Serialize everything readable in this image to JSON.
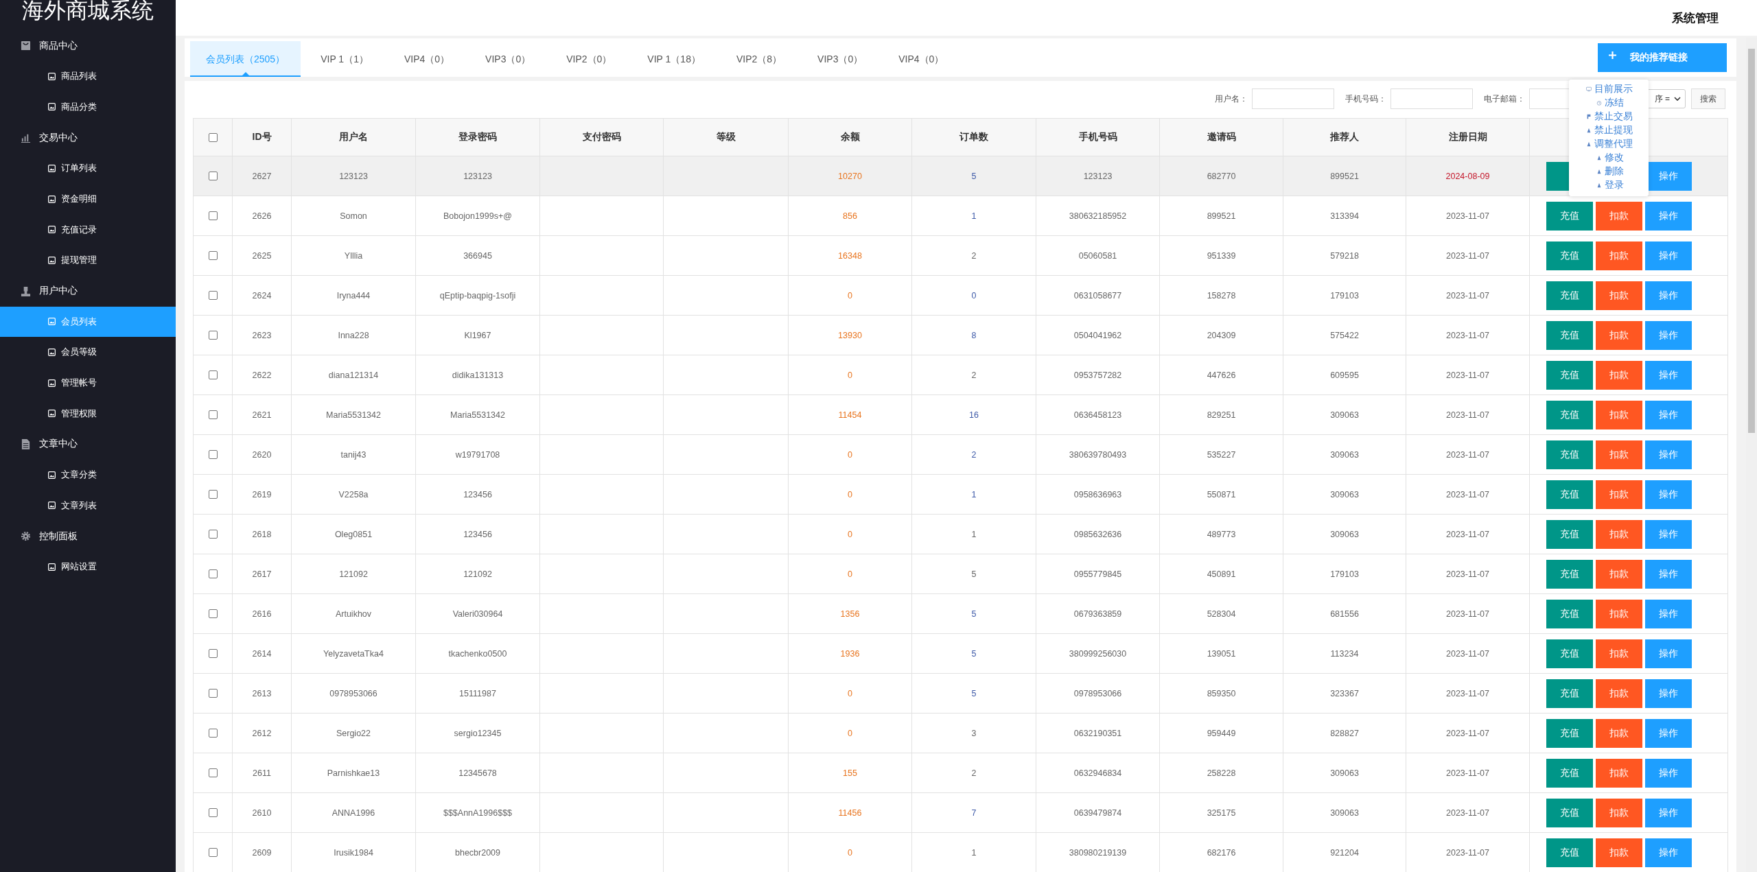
{
  "sidebar": {
    "title": "海外商城系统",
    "groups": [
      {
        "label": "商品中心",
        "items": [
          {
            "label": "商品列表",
            "selected": false
          },
          {
            "label": "商品分类",
            "selected": false
          }
        ]
      },
      {
        "label": "交易中心",
        "items": [
          {
            "label": "订单列表",
            "selected": false
          },
          {
            "label": "资金明细",
            "selected": false
          },
          {
            "label": "充值记录",
            "selected": false
          },
          {
            "label": "提现管理",
            "selected": false
          }
        ]
      },
      {
        "label": "用户中心",
        "items": [
          {
            "label": "会员列表",
            "selected": true
          },
          {
            "label": "会员等级",
            "selected": false
          },
          {
            "label": "管理帐号",
            "selected": false
          },
          {
            "label": "管理权限",
            "selected": false
          }
        ]
      },
      {
        "label": "文章中心",
        "items": [
          {
            "label": "文章分类",
            "selected": false
          },
          {
            "label": "文章列表",
            "selected": false
          }
        ]
      },
      {
        "label": "控制面板",
        "items": [
          {
            "label": "网站设置",
            "selected": false
          }
        ]
      }
    ]
  },
  "header": {
    "title": "系统管理"
  },
  "tabs": [
    {
      "label": "会员列表（2505）",
      "selected": true
    },
    {
      "label": "VIP 1（1）",
      "selected": false
    },
    {
      "label": "VIP4（0）",
      "selected": false
    },
    {
      "label": "VIP3（0）",
      "selected": false
    },
    {
      "label": "VIP2（0）",
      "selected": false
    },
    {
      "label": "VIP 1（18）",
      "selected": false
    },
    {
      "label": "VIP2（8）",
      "selected": false
    },
    {
      "label": "VIP3（0）",
      "selected": false
    },
    {
      "label": "VIP4（0）",
      "selected": false
    }
  ],
  "referral_button": "我的推荐链接",
  "filters": {
    "fields": [
      {
        "label": "用户名："
      },
      {
        "label": "手机号码："
      },
      {
        "label": "电子邮箱："
      }
    ],
    "sort": "序 =",
    "search_button": "搜索"
  },
  "menu": [
    {
      "label": "目前展示"
    },
    {
      "label": "冻结"
    },
    {
      "label": "禁止交易"
    },
    {
      "label": "禁止提现"
    },
    {
      "label": "调整代理"
    },
    {
      "label": "修改"
    },
    {
      "label": "删除"
    },
    {
      "label": "登录"
    }
  ],
  "table": {
    "all_checked": false,
    "columns": [
      "ID号",
      "用户名",
      "登录密码",
      "支付密码",
      "等级",
      "余额",
      "订单数",
      "手机号码",
      "邀请码",
      "推荐人",
      "注册日期"
    ],
    "rows": [
      {
        "id": "2627",
        "username": "123123",
        "login_password": "123123",
        "balance": "10270",
        "orders": "5",
        "orders_linked": true,
        "phone": "123123",
        "invite_code": "682770",
        "referrer": "899521",
        "registered": "2024-08-09",
        "date_highlight": true,
        "hovered": true,
        "checked": false,
        "actions": [
          {
            "kind": "recharge"
          },
          {
            "kind": "operate",
            "label": "操作"
          }
        ]
      },
      {
        "id": "2626",
        "username": "Somon",
        "login_password": "Bobojon1999s+@",
        "balance": "856",
        "orders": "1",
        "orders_linked": true,
        "phone": "380632185952",
        "invite_code": "899521",
        "referrer": "313394",
        "registered": "2023-11-07",
        "date_highlight": false,
        "hovered": false,
        "checked": false,
        "actions": [
          {
            "kind": "recharge",
            "label": "充值"
          },
          {
            "kind": "deduct",
            "label": "扣款"
          },
          {
            "kind": "operate",
            "label": "操作"
          }
        ]
      },
      {
        "id": "2625",
        "username": "Ylllia",
        "login_password": "366945",
        "balance": "16348",
        "orders": "2",
        "orders_linked": false,
        "phone": "05060581",
        "invite_code": "951339",
        "referrer": "579218",
        "registered": "2023-11-07",
        "date_highlight": false,
        "hovered": false,
        "checked": false,
        "actions": [
          {
            "kind": "recharge",
            "label": "充值"
          },
          {
            "kind": "deduct",
            "label": "扣款"
          },
          {
            "kind": "operate",
            "label": "操作"
          }
        ]
      },
      {
        "id": "2624",
        "username": "Iryna444",
        "login_password": "qEptip-baqpig-1sofji",
        "balance": "0",
        "orders": "0",
        "orders_linked": true,
        "phone": "0631058677",
        "invite_code": "158278",
        "referrer": "179103",
        "registered": "2023-11-07",
        "date_highlight": false,
        "hovered": false,
        "checked": false,
        "actions": [
          {
            "kind": "recharge",
            "label": "充值"
          },
          {
            "kind": "deduct",
            "label": "扣款"
          },
          {
            "kind": "operate",
            "label": "操作"
          }
        ]
      },
      {
        "id": "2623",
        "username": "Inna228",
        "login_password": "Kl1967",
        "balance": "13930",
        "orders": "8",
        "orders_linked": true,
        "phone": "0504041962",
        "invite_code": "204309",
        "referrer": "575422",
        "registered": "2023-11-07",
        "date_highlight": false,
        "hovered": false,
        "checked": false,
        "actions": [
          {
            "kind": "recharge",
            "label": "充值"
          },
          {
            "kind": "deduct",
            "label": "扣款"
          },
          {
            "kind": "operate",
            "label": "操作"
          }
        ]
      },
      {
        "id": "2622",
        "username": "diana121314",
        "login_password": "didika131313",
        "balance": "0",
        "orders": "2",
        "orders_linked": false,
        "phone": "0953757282",
        "invite_code": "447626",
        "referrer": "609595",
        "registered": "2023-11-07",
        "date_highlight": false,
        "hovered": false,
        "checked": false,
        "actions": [
          {
            "kind": "recharge",
            "label": "充值"
          },
          {
            "kind": "deduct",
            "label": "扣款"
          },
          {
            "kind": "operate",
            "label": "操作"
          }
        ]
      },
      {
        "id": "2621",
        "username": "Maria5531342",
        "login_password": "Maria5531342",
        "balance": "11454",
        "orders": "16",
        "orders_linked": true,
        "phone": "0636458123",
        "invite_code": "829251",
        "referrer": "309063",
        "registered": "2023-11-07",
        "date_highlight": false,
        "hovered": false,
        "checked": false,
        "actions": [
          {
            "kind": "recharge",
            "label": "充值"
          },
          {
            "kind": "deduct",
            "label": "扣款"
          },
          {
            "kind": "operate",
            "label": "操作"
          }
        ]
      },
      {
        "id": "2620",
        "username": "tanij43",
        "login_password": "w19791708",
        "balance": "0",
        "orders": "2",
        "orders_linked": true,
        "phone": "380639780493",
        "invite_code": "535227",
        "referrer": "309063",
        "registered": "2023-11-07",
        "date_highlight": false,
        "hovered": false,
        "checked": false,
        "actions": [
          {
            "kind": "recharge",
            "label": "充值"
          },
          {
            "kind": "deduct",
            "label": "扣款"
          },
          {
            "kind": "operate",
            "label": "操作"
          }
        ]
      },
      {
        "id": "2619",
        "username": "V2258a",
        "login_password": "123456",
        "balance": "0",
        "orders": "1",
        "orders_linked": true,
        "phone": "0958636963",
        "invite_code": "550871",
        "referrer": "309063",
        "registered": "2023-11-07",
        "date_highlight": false,
        "hovered": false,
        "checked": false,
        "actions": [
          {
            "kind": "recharge",
            "label": "充值"
          },
          {
            "kind": "deduct",
            "label": "扣款"
          },
          {
            "kind": "operate",
            "label": "操作"
          }
        ]
      },
      {
        "id": "2618",
        "username": "Oleg0851",
        "login_password": "123456",
        "balance": "0",
        "orders": "1",
        "orders_linked": false,
        "phone": "0985632636",
        "invite_code": "489773",
        "referrer": "309063",
        "registered": "2023-11-07",
        "date_highlight": false,
        "hovered": false,
        "checked": false,
        "actions": [
          {
            "kind": "recharge",
            "label": "充值"
          },
          {
            "kind": "deduct",
            "label": "扣款"
          },
          {
            "kind": "operate",
            "label": "操作"
          }
        ]
      },
      {
        "id": "2617",
        "username": "121092",
        "login_password": "121092",
        "balance": "0",
        "orders": "5",
        "orders_linked": false,
        "phone": "0955779845",
        "invite_code": "450891",
        "referrer": "179103",
        "registered": "2023-11-07",
        "date_highlight": false,
        "hovered": false,
        "checked": false,
        "actions": [
          {
            "kind": "recharge",
            "label": "充值"
          },
          {
            "kind": "deduct",
            "label": "扣款"
          },
          {
            "kind": "operate",
            "label": "操作"
          }
        ]
      },
      {
        "id": "2616",
        "username": "Artuikhov",
        "login_password": "Valeri030964",
        "balance": "1356",
        "orders": "5",
        "orders_linked": true,
        "phone": "0679363859",
        "invite_code": "528304",
        "referrer": "681556",
        "registered": "2023-11-07",
        "date_highlight": false,
        "hovered": false,
        "checked": false,
        "actions": [
          {
            "kind": "recharge",
            "label": "充值"
          },
          {
            "kind": "deduct",
            "label": "扣款"
          },
          {
            "kind": "operate",
            "label": "操作"
          }
        ]
      },
      {
        "id": "2614",
        "username": "YelyzavetaTka4",
        "login_password": "tkachenko0500",
        "balance": "1936",
        "orders": "5",
        "orders_linked": true,
        "phone": "380999256030",
        "invite_code": "139051",
        "referrer": "113234",
        "registered": "2023-11-07",
        "date_highlight": false,
        "hovered": false,
        "checked": false,
        "actions": [
          {
            "kind": "recharge",
            "label": "充值"
          },
          {
            "kind": "deduct",
            "label": "扣款"
          },
          {
            "kind": "operate",
            "label": "操作"
          }
        ]
      },
      {
        "id": "2613",
        "username": "0978953066",
        "login_password": "15111987",
        "balance": "0",
        "orders": "5",
        "orders_linked": true,
        "phone": "0978953066",
        "invite_code": "859350",
        "referrer": "323367",
        "registered": "2023-11-07",
        "date_highlight": false,
        "hovered": false,
        "checked": false,
        "actions": [
          {
            "kind": "recharge",
            "label": "充值"
          },
          {
            "kind": "deduct",
            "label": "扣款"
          },
          {
            "kind": "operate",
            "label": "操作"
          }
        ]
      },
      {
        "id": "2612",
        "username": "Sergio22",
        "login_password": "sergio12345",
        "balance": "0",
        "orders": "3",
        "orders_linked": false,
        "phone": "0632190351",
        "invite_code": "959449",
        "referrer": "828827",
        "registered": "2023-11-07",
        "date_highlight": false,
        "hovered": false,
        "checked": false,
        "actions": [
          {
            "kind": "recharge",
            "label": "充值"
          },
          {
            "kind": "deduct",
            "label": "扣款"
          },
          {
            "kind": "operate",
            "label": "操作"
          }
        ]
      },
      {
        "id": "2611",
        "username": "Parnishkae13",
        "login_password": "12345678",
        "balance": "155",
        "orders": "2",
        "orders_linked": false,
        "phone": "0632946834",
        "invite_code": "258228",
        "referrer": "309063",
        "registered": "2023-11-07",
        "date_highlight": false,
        "hovered": false,
        "checked": false,
        "actions": [
          {
            "kind": "recharge",
            "label": "充值"
          },
          {
            "kind": "deduct",
            "label": "扣款"
          },
          {
            "kind": "operate",
            "label": "操作"
          }
        ]
      },
      {
        "id": "2610",
        "username": "ANNA1996",
        "login_password": "$$$AnnA1996$$$",
        "balance": "11456",
        "orders": "7",
        "orders_linked": true,
        "phone": "0639479874",
        "invite_code": "325175",
        "referrer": "309063",
        "registered": "2023-11-07",
        "date_highlight": false,
        "hovered": false,
        "checked": false,
        "actions": [
          {
            "kind": "recharge",
            "label": "充值"
          },
          {
            "kind": "deduct",
            "label": "扣款"
          },
          {
            "kind": "operate",
            "label": "操作"
          }
        ]
      },
      {
        "id": "2609",
        "username": "Irusik1984",
        "login_password": "bhecbr2009",
        "balance": "0",
        "orders": "1",
        "orders_linked": false,
        "phone": "380980219139",
        "invite_code": "682176",
        "referrer": "921204",
        "registered": "2023-11-07",
        "date_highlight": false,
        "hovered": false,
        "checked": false,
        "actions": [
          {
            "kind": "recharge",
            "label": "充值"
          },
          {
            "kind": "deduct",
            "label": "扣款"
          },
          {
            "kind": "operate",
            "label": "操作"
          }
        ]
      }
    ]
  }
}
